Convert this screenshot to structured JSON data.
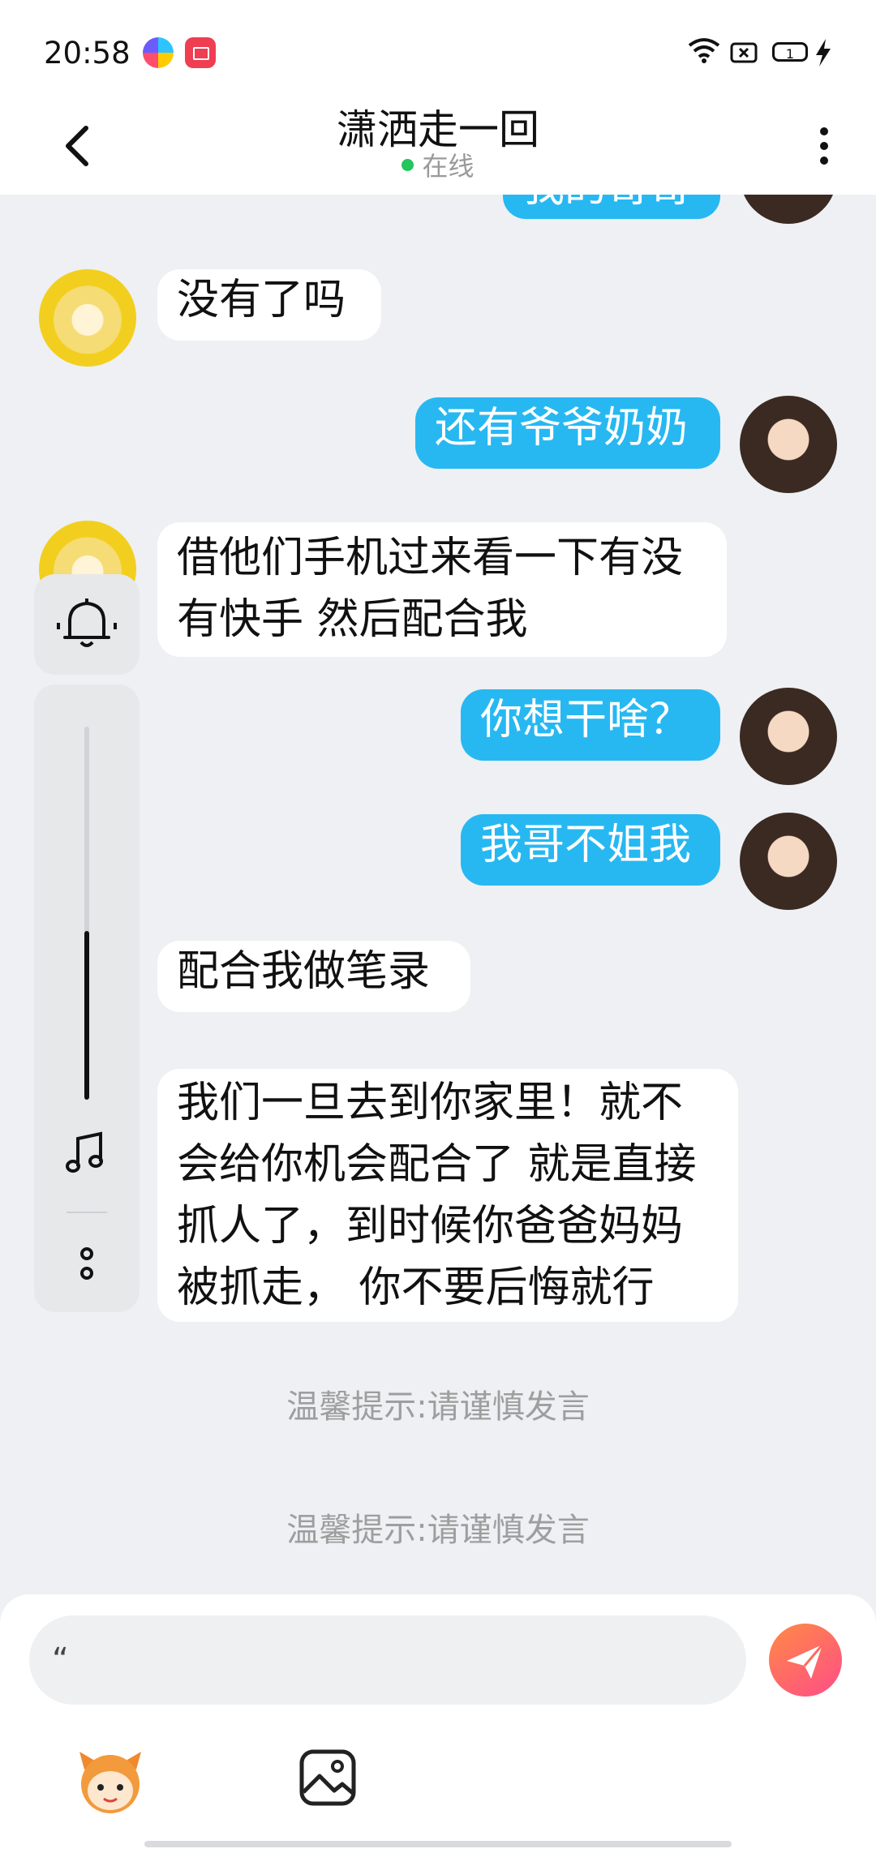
{
  "status_bar": {
    "time": "20:58",
    "battery_level": "1"
  },
  "header": {
    "title": "潇洒走一回",
    "status": "在线"
  },
  "messages": [
    {
      "side": "right",
      "text": "我的哥哥"
    },
    {
      "side": "left",
      "text": "没有了吗"
    },
    {
      "side": "right",
      "text": "还有爷爷奶奶"
    },
    {
      "side": "left",
      "text": "借他们手机过来看一下有没\n有快手 然后配合我"
    },
    {
      "side": "right",
      "text": "你想干啥？"
    },
    {
      "side": "right",
      "text": "我哥不姐我"
    },
    {
      "side": "left",
      "text": "配合我做笔录"
    },
    {
      "side": "left",
      "text": "我们一旦去到你家里！就不\n会给你机会配合了 就是直接\n抓人了，到时候你爸爸妈妈\n被抓走， 你不要后悔就行"
    }
  ],
  "hints": [
    "温馨提示:请谨慎发言",
    "温馨提示:请谨慎发言"
  ],
  "composer": {
    "input_value": "“",
    "send_label": "send"
  },
  "colors": {
    "accent": "#27b8f2",
    "send_gradient_start": "#ff8a44",
    "send_gradient_end": "#ff4d88",
    "online": "#22c55e"
  }
}
